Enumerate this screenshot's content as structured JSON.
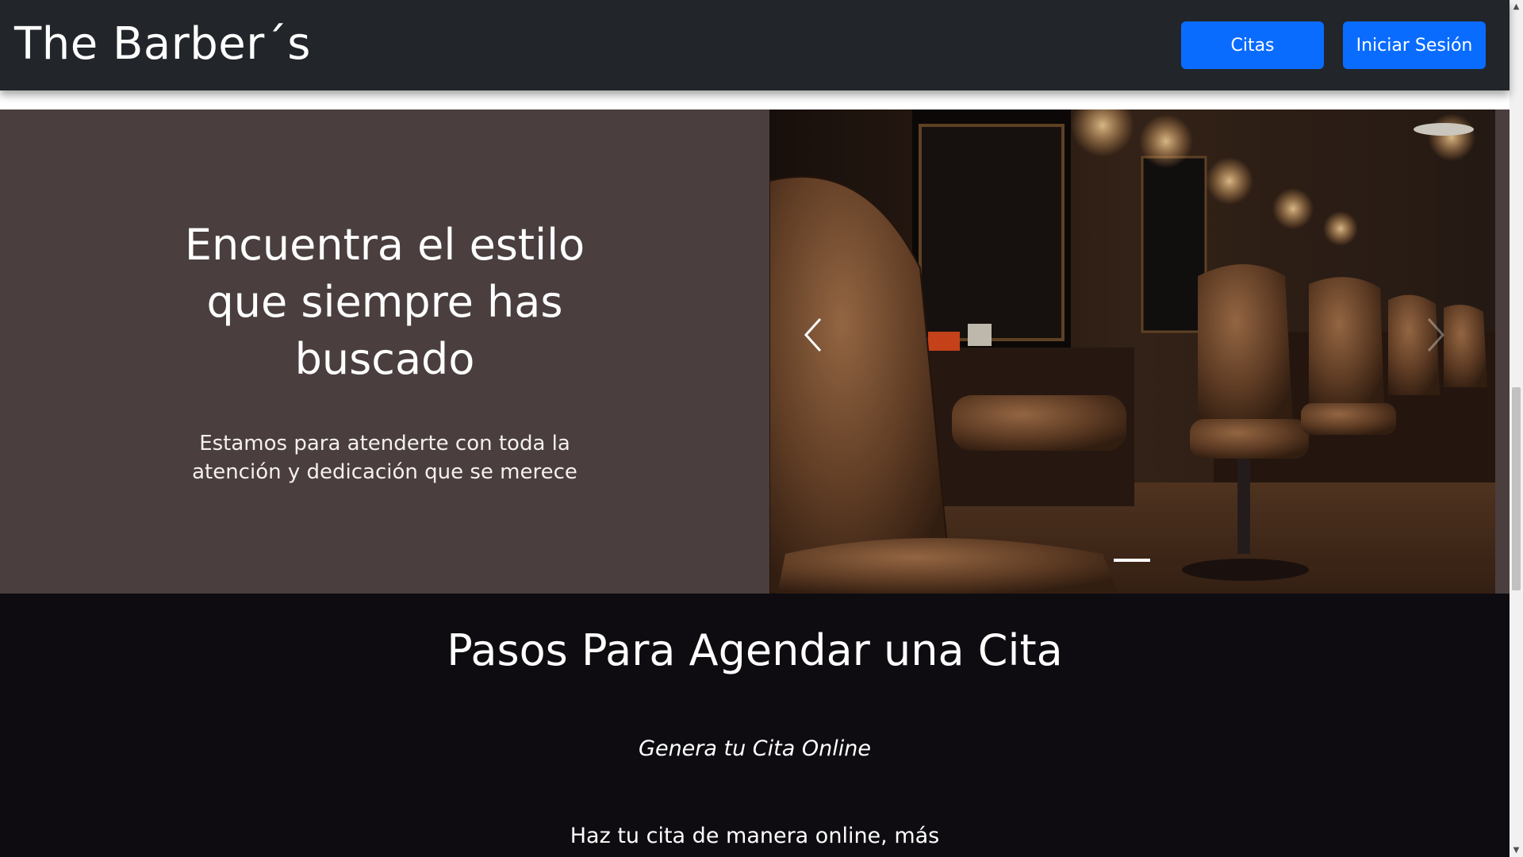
{
  "navbar": {
    "brand": "The Barber´s",
    "buttons": {
      "citas": "Citas",
      "login": "Iniciar Sesión"
    }
  },
  "hero": {
    "title": "Encuentra el estilo que siempre has buscado",
    "subtitle": "Estamos para atenderte con toda la atención y dedicación que se merece",
    "carousel": {
      "prev_icon": "chevron-left-icon",
      "next_icon": "chevron-right-icon",
      "active_slide": 1,
      "image_subject": "barbershop-interior-photo"
    }
  },
  "steps": {
    "title": "Pasos Para Agendar una Cita",
    "subtitle": "Genera tu Cita Online",
    "description": "Haz tu cita de manera online, más"
  },
  "colors": {
    "navbar_bg": "#22252a",
    "accent": "#0a6cff",
    "hero_bg": "#4a3e3e",
    "section_bg": "#0e0c10"
  }
}
